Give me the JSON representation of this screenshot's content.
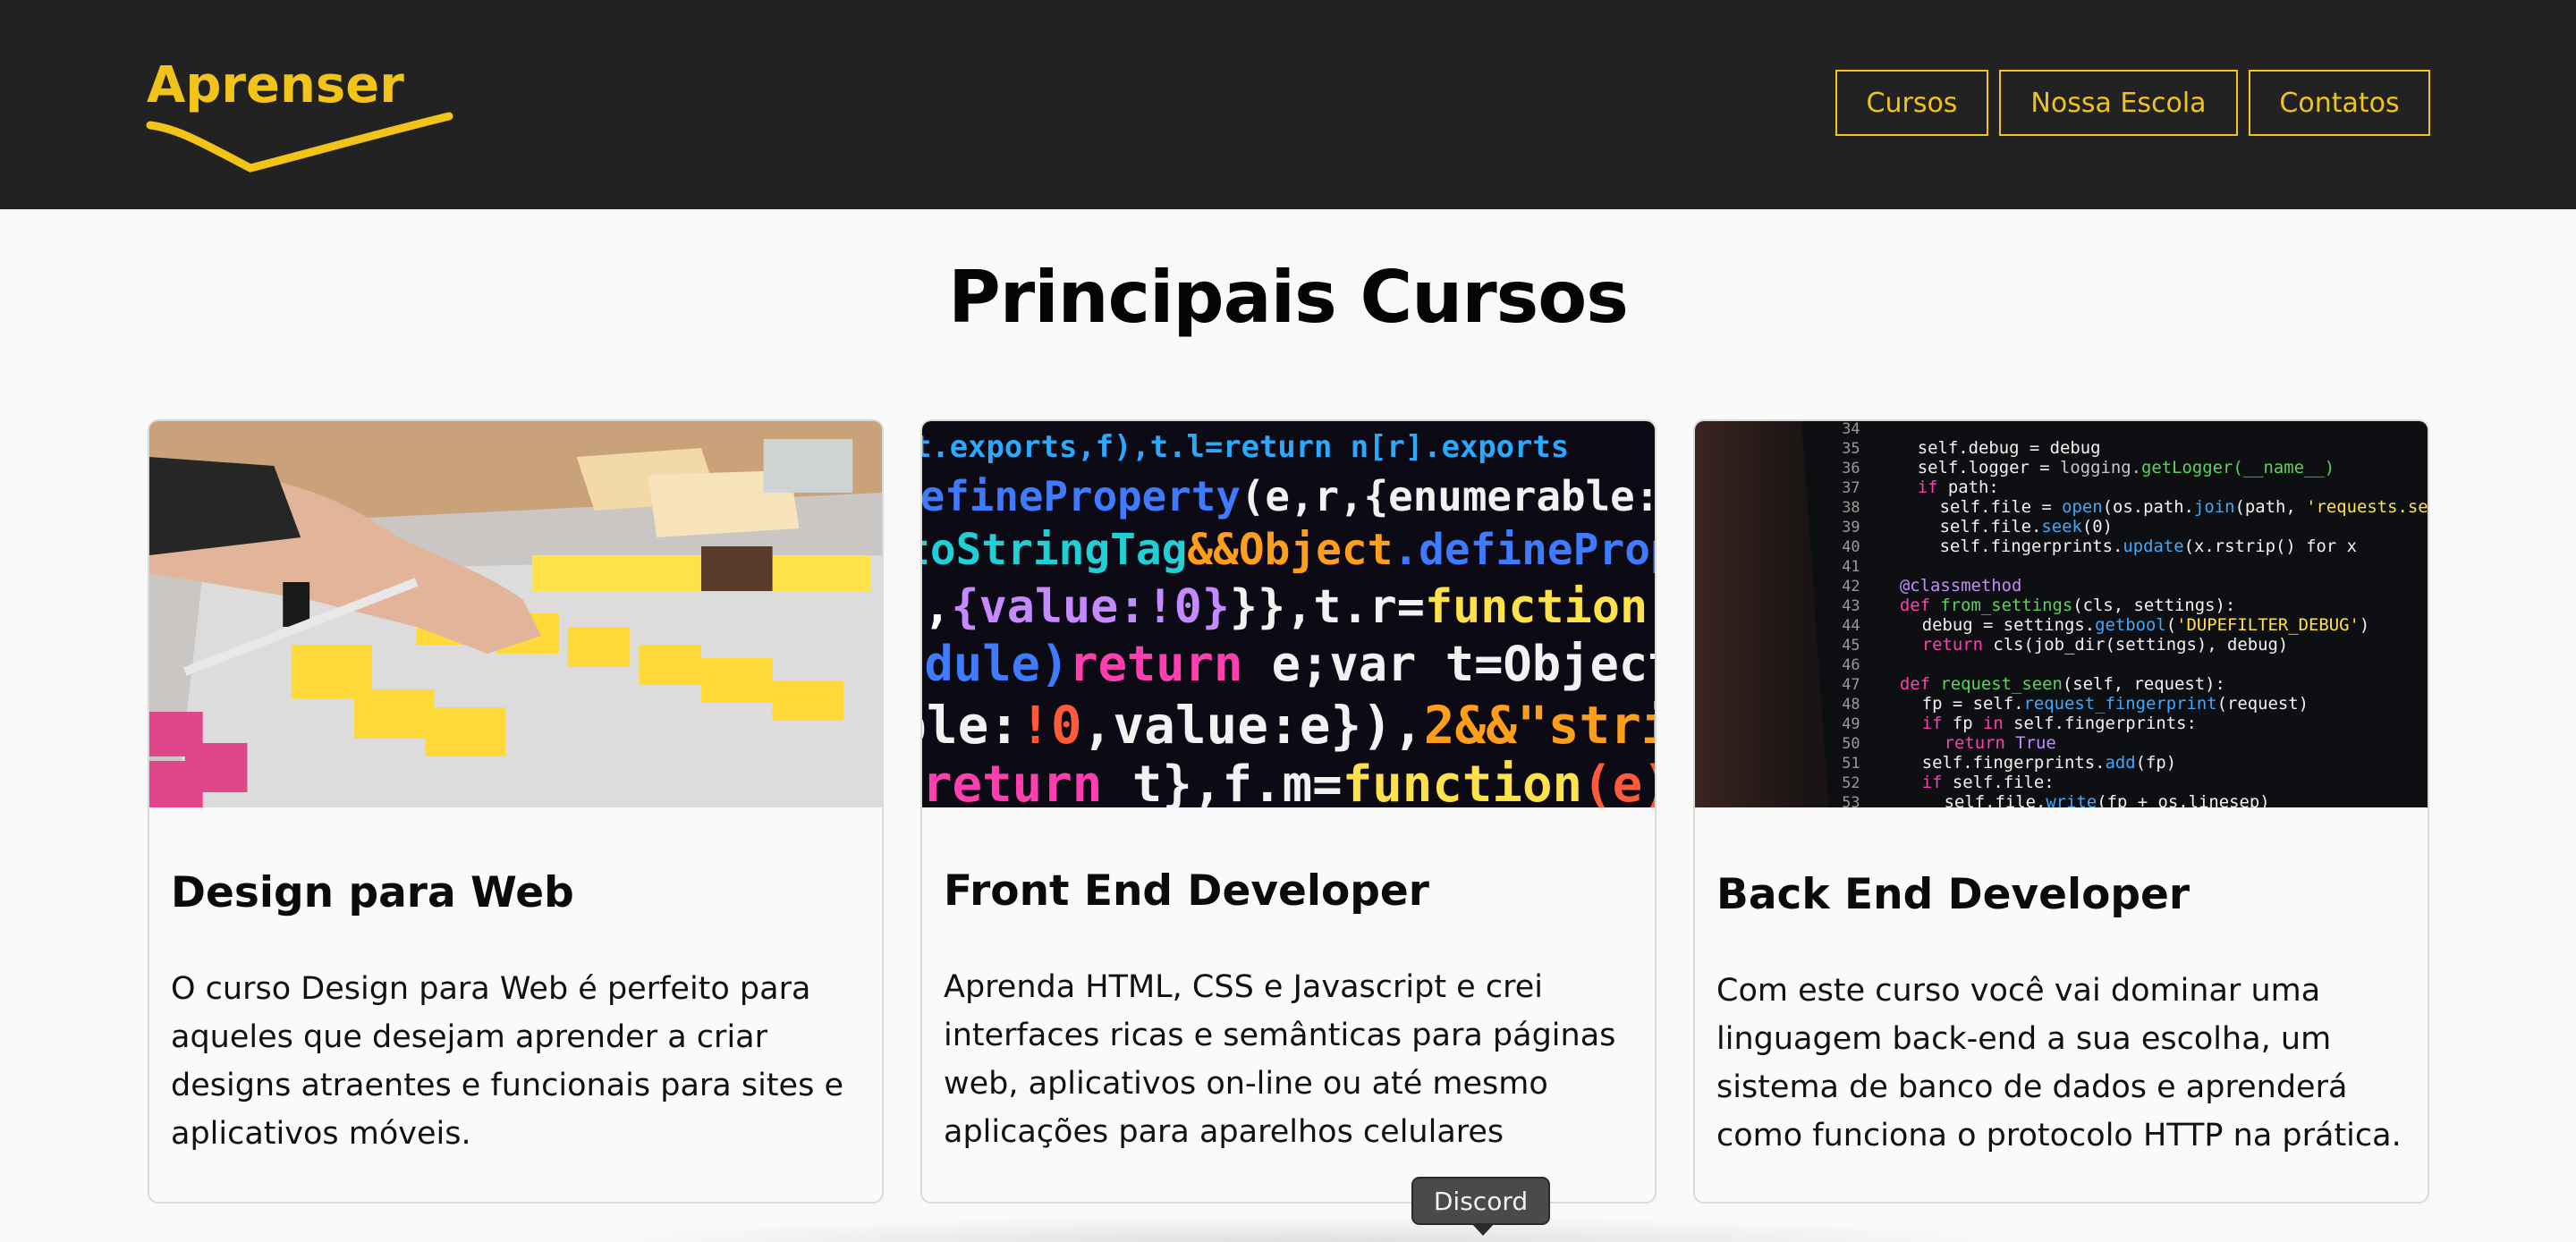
{
  "header": {
    "logo_text": "Aprenser",
    "nav": [
      {
        "label": "Cursos"
      },
      {
        "label": "Nossa Escola"
      },
      {
        "label": "Contatos"
      }
    ]
  },
  "main": {
    "title": "Principais Cursos",
    "cards": [
      {
        "title": "Design para Web",
        "image": "sticky-notes-planning-photo",
        "lines": [
          "O curso Design para Web é perfeito para",
          "aqueles que desejam aprender a criar",
          "designs atraentes e funcionais para sites e",
          "aplicativos móveis."
        ]
      },
      {
        "title": "Front End Developer",
        "image": "colorful-code-screen-photo",
        "lines": [
          "Aprenda HTML, CSS e Javascript e crei",
          "interfaces ricas e semânticas para páginas",
          "web, aplicativos on-line ou até mesmo",
          "aplicações para aparelhos celulares"
        ]
      },
      {
        "title": "Back End Developer",
        "image": "python-code-monitor-photo",
        "lines": [
          "Com este curso você vai dominar uma",
          "linguagem back-end a sua escolha, um",
          "sistema de banco de dados e aprenderá",
          "como funciona o protocolo HTTP na prática."
        ]
      }
    ]
  },
  "tooltip": {
    "label": "Discord"
  },
  "colors": {
    "header_bg": "#222222",
    "accent": "#f2c318",
    "page_bg": "#f9f9f9"
  }
}
